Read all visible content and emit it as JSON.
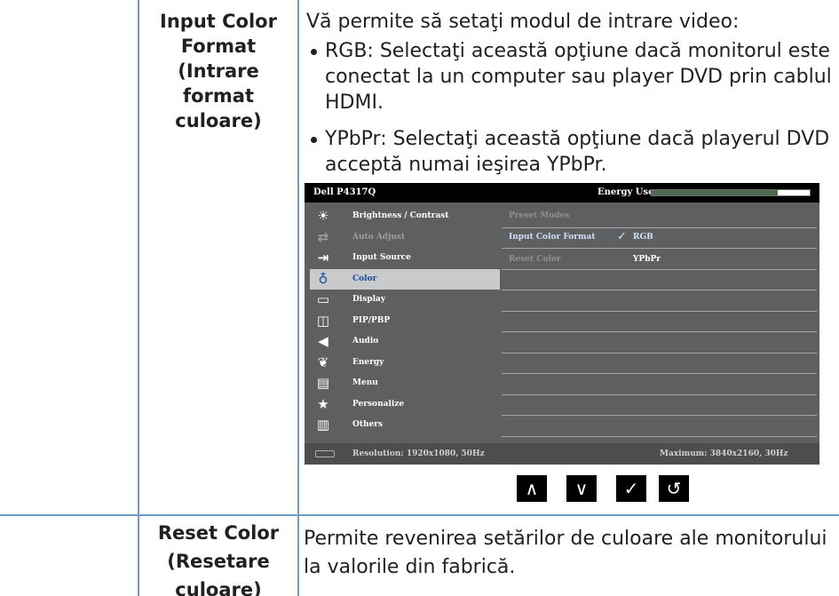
{
  "rows": [
    {
      "term": [
        "Input Color",
        "Format",
        "(Intrare format",
        "culoare)"
      ],
      "description": "Vă permite să setaţi modul de intrare video:",
      "bullets": [
        [
          "RGB: Selectaţi această opţiune dacă monitorul este",
          "conectat la un computer sau player DVD prin cablul",
          "HDMI."
        ],
        [
          "YPbPr: Selectaţi această opţiune dacă playerul DVD",
          "acceptă numai ieşirea YPbPr."
        ]
      ]
    },
    {
      "term": [
        "Reset Color",
        "(Resetare",
        "culoare)"
      ],
      "description": [
        "Permite revenirea setărilor de culoare ale monitorului",
        "la valorile din fabrică."
      ]
    }
  ],
  "osd": {
    "model": "Dell P4317Q",
    "energy_label": "Energy Use",
    "energy_level": 0.8,
    "menu": [
      {
        "label": "Brightness / Contrast",
        "icon": "sun-icon",
        "glyph": "☀",
        "state": "normal"
      },
      {
        "label": "Auto Adjust",
        "icon": "auto-adjust-icon",
        "glyph": "⇄",
        "state": "dim"
      },
      {
        "label": "Input Source",
        "icon": "input-source-icon",
        "glyph": "⇥",
        "state": "normal"
      },
      {
        "label": "Color",
        "icon": "color-icon",
        "glyph": "♁",
        "state": "selected"
      },
      {
        "label": "Display",
        "icon": "display-icon",
        "glyph": "▭",
        "state": "normal"
      },
      {
        "label": "PIP/PBP",
        "icon": "pip-icon",
        "glyph": "◫",
        "state": "normal"
      },
      {
        "label": "Audio",
        "icon": "speaker-icon",
        "glyph": "◀",
        "state": "normal"
      },
      {
        "label": "Energy",
        "icon": "leaf-icon",
        "glyph": "❦",
        "state": "normal"
      },
      {
        "label": "Menu",
        "icon": "menu-icon",
        "glyph": "▤",
        "state": "normal"
      },
      {
        "label": "Personalize",
        "icon": "star-icon",
        "glyph": "★",
        "state": "normal"
      },
      {
        "label": "Others",
        "icon": "others-icon",
        "glyph": "▥",
        "state": "normal"
      }
    ],
    "submenu": {
      "preset_modes": "Preset Modes",
      "input_color_format": "Input Color Format",
      "check": "✓",
      "rgb": "RGB",
      "reset_color": "Reset Color",
      "ypbpr": "YPbPr"
    },
    "resolution": "Resolution: 1920x1080, 50Hz",
    "maximum": "Maximum: 3840x2160, 30Hz",
    "nav_buttons": [
      {
        "name": "up-button",
        "glyph": "∧"
      },
      {
        "name": "down-button",
        "glyph": "∨"
      },
      {
        "name": "confirm-button",
        "glyph": "✓"
      },
      {
        "name": "back-button",
        "glyph": "↺"
      }
    ]
  },
  "colors": {
    "grid_line": "#6d9cc8",
    "osd_bg": "#5d5f61",
    "osd_selected": "#c9cacc",
    "osd_selected_text": "#1a4e9a"
  }
}
